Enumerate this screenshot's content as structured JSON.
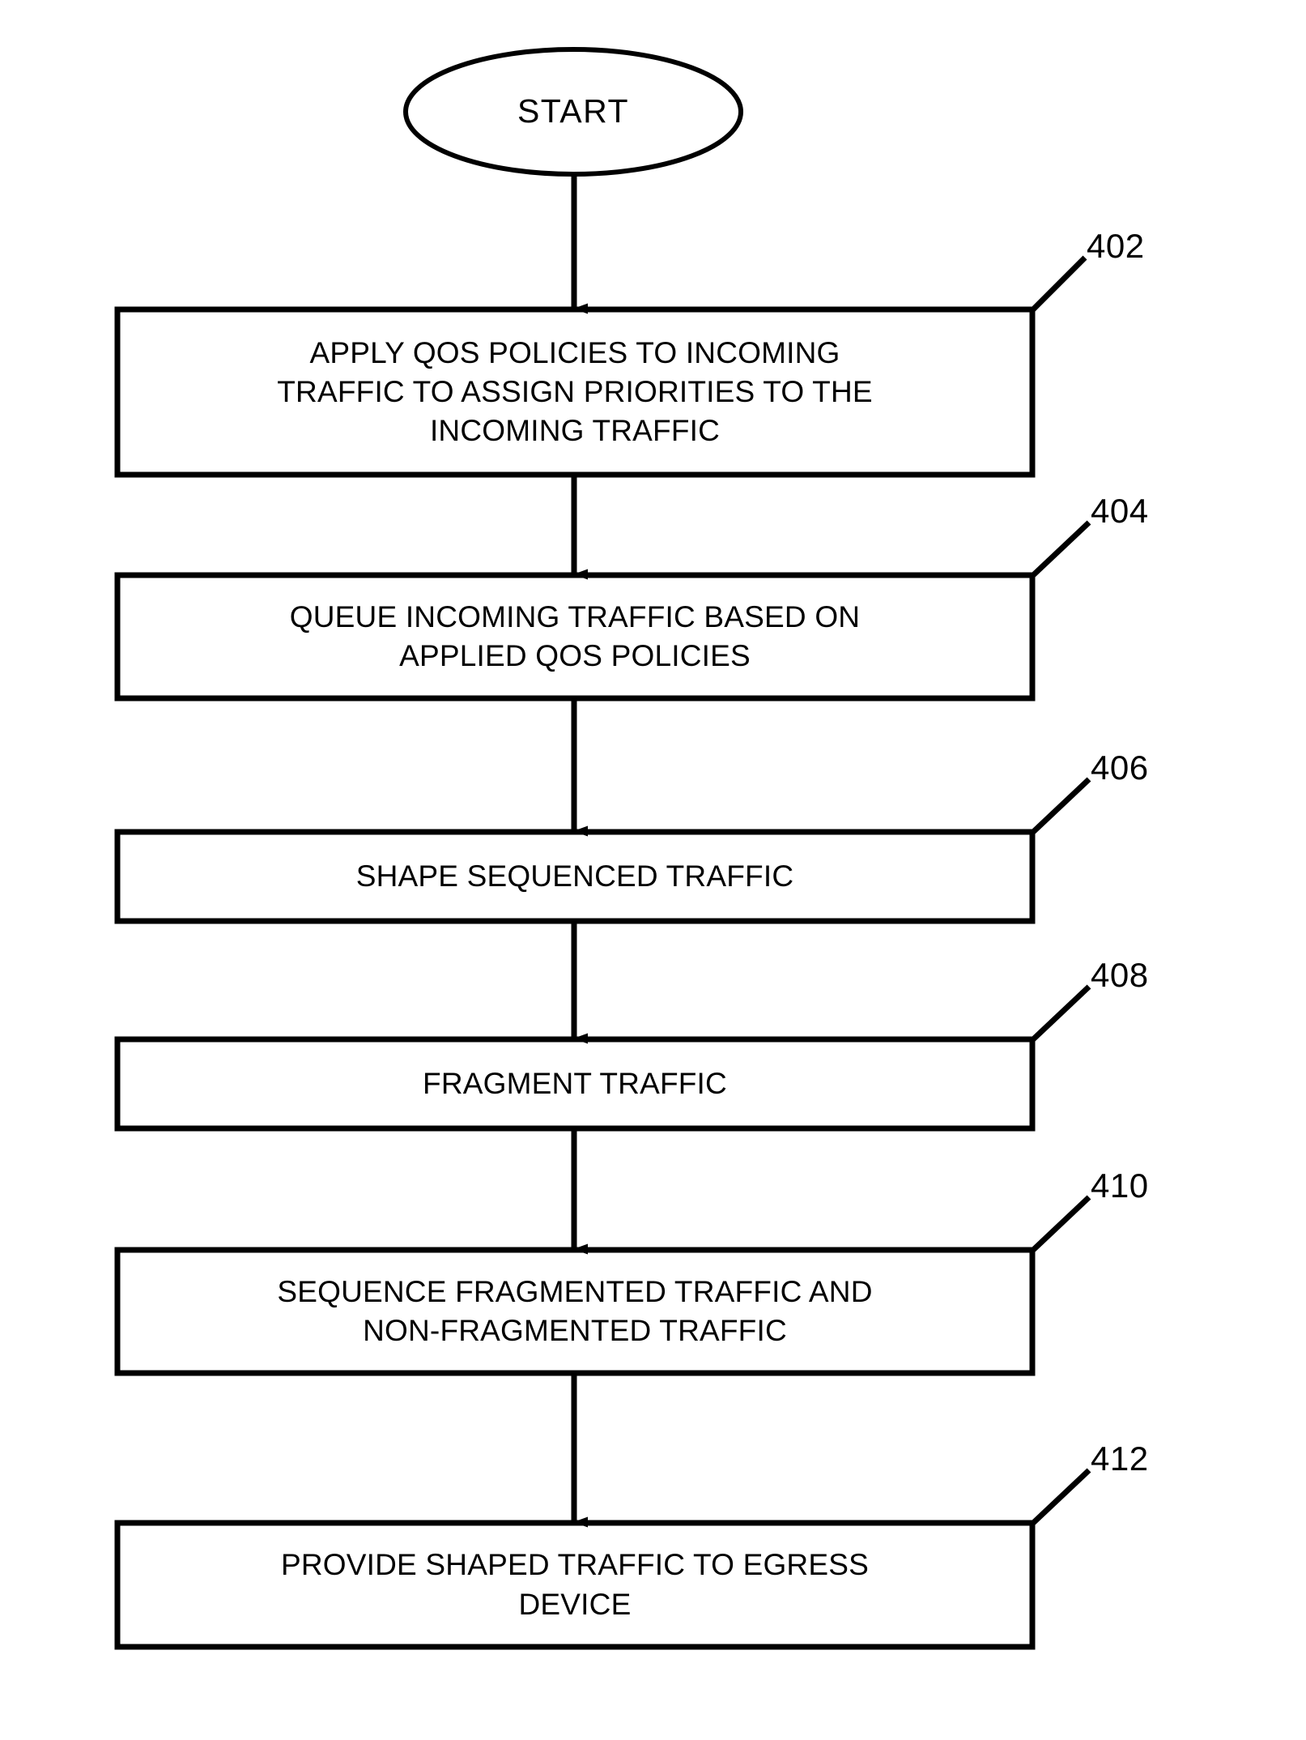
{
  "figure": {
    "type": "flowchart",
    "orientation": "vertical",
    "stroke_color": "#000000",
    "background_color": "#ffffff",
    "start_node": {
      "label": "START",
      "shape": "ellipse"
    },
    "steps": [
      {
        "ref": "402",
        "text": "APPLY QOS POLICIES TO INCOMING\nTRAFFIC TO ASSIGN PRIORITIES TO THE\nINCOMING TRAFFIC",
        "lines": 3
      },
      {
        "ref": "404",
        "text": "QUEUE INCOMING TRAFFIC BASED ON\nAPPLIED QOS POLICIES",
        "lines": 2
      },
      {
        "ref": "406",
        "text": "SHAPE SEQUENCED TRAFFIC",
        "lines": 1
      },
      {
        "ref": "408",
        "text": "FRAGMENT TRAFFIC",
        "lines": 1
      },
      {
        "ref": "410",
        "text": "SEQUENCE FRAGMENTED TRAFFIC AND\nNON-FRAGMENTED TRAFFIC",
        "lines": 2
      },
      {
        "ref": "412",
        "text": "PROVIDE SHAPED TRAFFIC TO EGRESS\nDEVICE",
        "lines": 2
      }
    ]
  }
}
